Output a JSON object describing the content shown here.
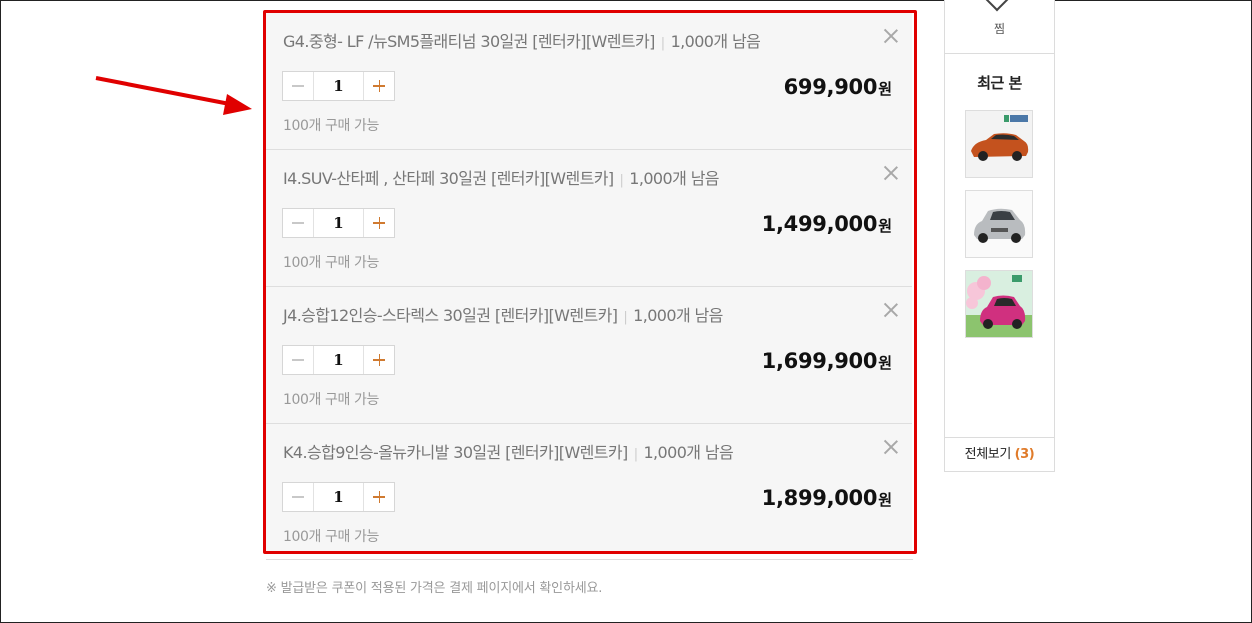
{
  "options": [
    {
      "title": "G4.중형- LF /뉴SM5플래티넘 30일권 [렌터카][W렌트카]",
      "stock": "1,000개 남음",
      "qty": "1",
      "price": "699,900",
      "currency": "원",
      "avail": "100개 구매 가능"
    },
    {
      "title": "I4.SUV-산타페 , 산타페 30일권 [렌터카][W렌트카]",
      "stock": "1,000개 남음",
      "qty": "1",
      "price": "1,499,000",
      "currency": "원",
      "avail": "100개 구매 가능"
    },
    {
      "title": "J4.승합12인승-스타렉스 30일권 [렌터카][W렌트카]",
      "stock": "1,000개 남음",
      "qty": "1",
      "price": "1,699,900",
      "currency": "원",
      "avail": "100개 구매 가능"
    },
    {
      "title": "K4.승합9인승-올뉴카니발 30일권 [렌터카][W렌트카]",
      "stock": "1,000개 남음",
      "qty": "1",
      "price": "1,899,000",
      "currency": "원",
      "avail": "100개 구매 가능"
    }
  ],
  "notice": "※ 발급받은 쿠폰이 적용된 가격은 결제 페이지에서 확인하세요.",
  "sidebar": {
    "wish_label": "찜",
    "recent_title": "최근 본",
    "view_all_label": "전체보기",
    "view_all_count": "(3)",
    "thumbs": [
      {
        "name": "orange-sedan-thumbnail",
        "color": "#c4521e"
      },
      {
        "name": "silver-hatchback-thumbnail",
        "color": "#b9bcbf"
      },
      {
        "name": "pink-hatchback-thumbnail",
        "color": "#d0307f"
      }
    ]
  },
  "colors": {
    "highlight_border": "#e00000",
    "accent": "#e07b2a"
  }
}
